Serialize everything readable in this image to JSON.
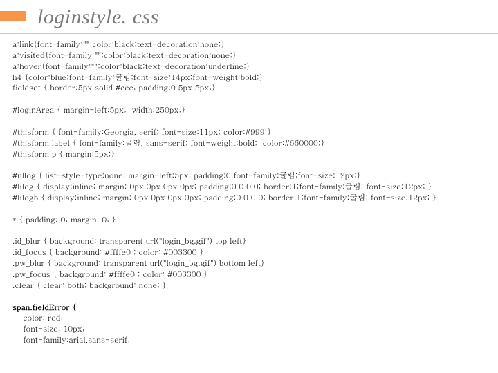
{
  "title": "loginstyle. css",
  "lines": [
    {
      "t": "a:link{font-family:\"\";color:black;text-decoration:none;}",
      "b": false
    },
    {
      "t": "a:visited{font-family:\"\";color:black;text-decoration:none;}",
      "b": false
    },
    {
      "t": "a:hover{font-family:\"\";color:black;text-decoration:underline;}",
      "b": false
    },
    {
      "t": "h4 {color:blue;font-family:굴림;font-size:14px;font-weight:bold;}",
      "b": false
    },
    {
      "t": "fieldset { border:5px solid #ccc; padding:0 5px 5px;}",
      "b": false
    },
    {
      "t": "",
      "b": false
    },
    {
      "t": "#loginArea { margin-left:5px;  width:250px;}",
      "b": false
    },
    {
      "t": "",
      "b": false
    },
    {
      "t": "#thisform { font-family:Georgia, serif; font-size:11px; color:#999;}",
      "b": false
    },
    {
      "t": "#thisform label { font-family:굴림, sans-serif; font-weight:bold;  color:#660000;}",
      "b": false
    },
    {
      "t": "#thisform p { margin:5px;}",
      "b": false
    },
    {
      "t": "",
      "b": false
    },
    {
      "t": "#ullog { list-style-type:none; margin-left:5px; padding:0;font-family:굴림;font-size:12px;}",
      "b": false
    },
    {
      "t": "#lilog { display:inline; margin: 0px 0px 0px 0px; padding:0 0 0 0; border:1;font-family:굴림; font-size:12px; }",
      "b": false
    },
    {
      "t": "#lilogb { display:inline; margin: 0px 0px 0px 0px; padding:0 0 0 0; border:1;font-family:굴림; font-size:12px; }",
      "b": false
    },
    {
      "t": "",
      "b": false
    },
    {
      "t": "* { padding: 0; margin: 0; }",
      "b": false
    },
    {
      "t": "",
      "b": false
    },
    {
      "t": ".id_blur { background: transparent url(\"login_bg.gif\") top left}",
      "b": false
    },
    {
      "t": ".id_focus { background: #ffffe0 ; color: #003300 }",
      "b": false
    },
    {
      "t": ".pw_blur { background: transparent url(\"login_bg.gif\") bottom left}",
      "b": false
    },
    {
      "t": ".pw_focus { background: #ffffe0 ; color: #003300 }",
      "b": false
    },
    {
      "t": ".clear { clear: both; background: none; }",
      "b": false
    },
    {
      "t": "",
      "b": false
    },
    {
      "t": "span.fieldError {",
      "b": true
    },
    {
      "t": "    color: red;",
      "b": false
    },
    {
      "t": "    font-size: 10px;",
      "b": false
    },
    {
      "t": "    font-family:arial,sans-serif;",
      "b": false
    }
  ]
}
